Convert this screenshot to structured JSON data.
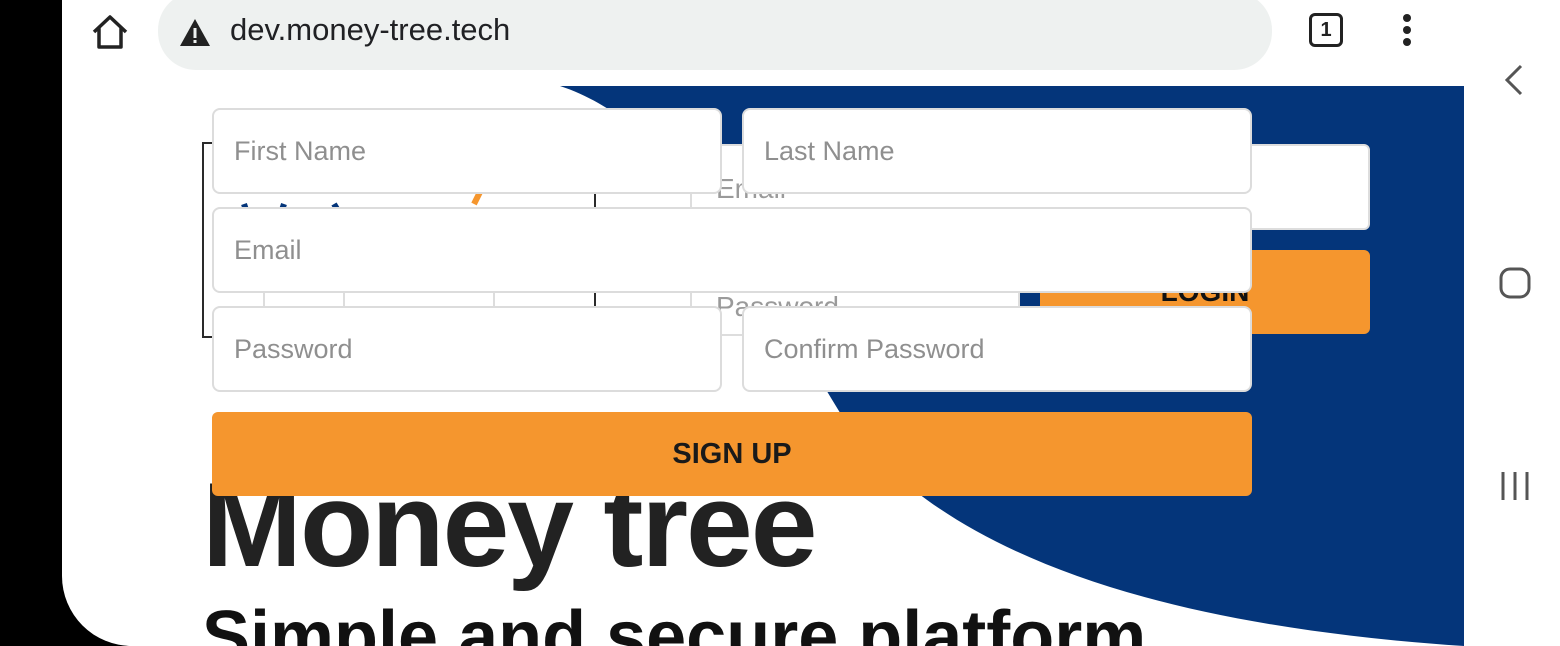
{
  "browser": {
    "url": "dev.money-tree.tech",
    "tab_count": "1"
  },
  "background_page": {
    "email_placeholder": "Email",
    "password_placeholder": "Password",
    "login_label": "LOGIN",
    "heading": "Money tree",
    "subheading": "Simple and secure platform"
  },
  "signup_form": {
    "first_name_placeholder": "First Name",
    "last_name_placeholder": "Last Name",
    "email_placeholder": "Email",
    "password_placeholder": "Password",
    "confirm_password_placeholder": "Confirm Password",
    "submit_label": "SIGN UP"
  },
  "colors": {
    "accent": "#f5962e",
    "navy": "#04357a"
  }
}
